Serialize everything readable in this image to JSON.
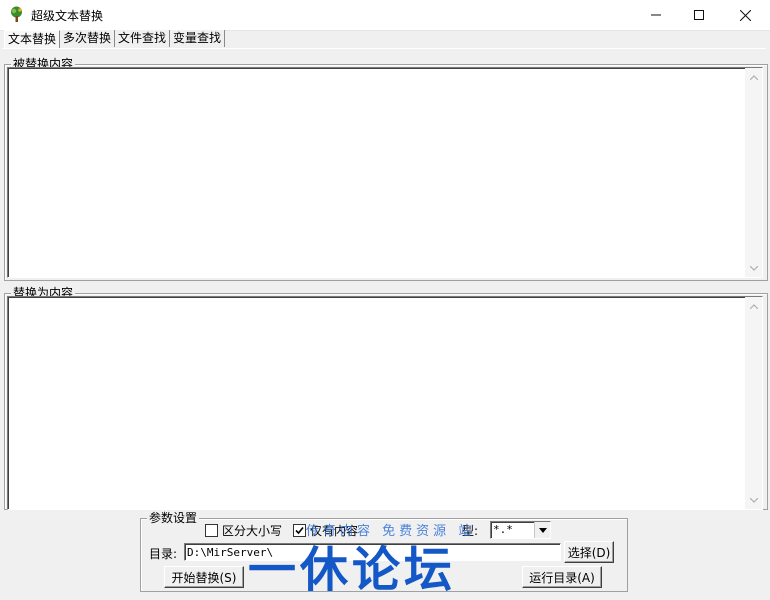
{
  "window": {
    "title": "超级文本替换",
    "controls": {
      "minimize": "—",
      "maximize": "☐",
      "close": "✕"
    }
  },
  "tabs": [
    {
      "label": "文本替换",
      "active": true
    },
    {
      "label": "多次替换",
      "active": false
    },
    {
      "label": "文件查找",
      "active": false
    },
    {
      "label": "变量查找",
      "active": false
    }
  ],
  "source_group": {
    "label": "被替换内容",
    "value": ""
  },
  "target_group": {
    "label": "替换为内容",
    "value": ""
  },
  "params": {
    "label": "参数设置",
    "case_sensitive": {
      "label": "区分大小写",
      "checked": false
    },
    "second_checkbox": {
      "label": "仅有内容",
      "checked": true
    },
    "type_label": "型:",
    "type_value": "*.*",
    "dir_label": "目录:",
    "dir_value": "D:\\MirServer\\",
    "choose_button": "选择(D)",
    "start_button": "开始替换(S)",
    "run_dir_button": "运行目录(A)"
  },
  "watermark": {
    "small": "传奇内容 免费资源 站",
    "big": "一休论坛"
  },
  "colors": {
    "watermark": "#1457c6",
    "window_bg": "#f0f0f0"
  }
}
